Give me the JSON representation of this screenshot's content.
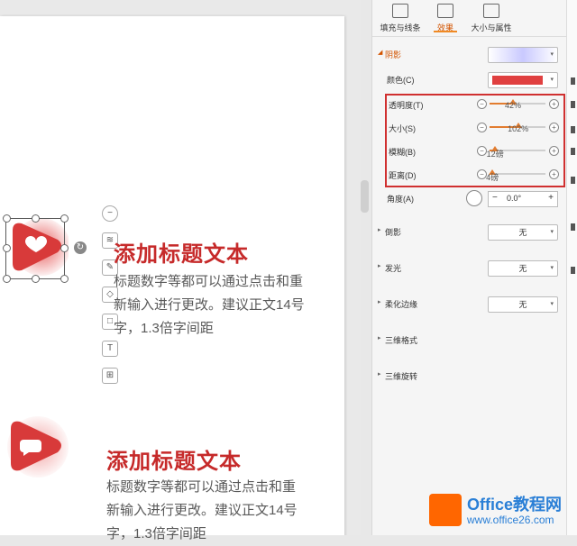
{
  "slide": {
    "blocks": [
      {
        "title": "添加标题文本",
        "body": "标题数字等都可以通过点击和重新输入进行更改。建议正文14号字，1.3倍字间距"
      },
      {
        "title": "添加标题文本",
        "body": "标题数字等都可以通过点击和重新输入进行更改。建议正文14号字，1.3倍字间距"
      }
    ],
    "accent_color": "#d83a3a"
  },
  "float_toolbar": {
    "icons": [
      "minus-circle-icon",
      "layers-icon",
      "pen-icon",
      "fill-icon",
      "outline-icon",
      "text-wrap-icon",
      "group-icon"
    ]
  },
  "panel": {
    "tabs": [
      {
        "label": "填充与线条",
        "icon": "paint-bucket-icon"
      },
      {
        "label": "效果",
        "icon": "effects-icon",
        "active": true
      },
      {
        "label": "大小与属性",
        "icon": "size-icon"
      }
    ],
    "shadow": {
      "label": "阴影",
      "color_label": "颜色(C)",
      "color": "#e04040",
      "preset_color": "#c9c9ff",
      "transparency": {
        "label": "透明度(T)",
        "value_text": "42%",
        "fraction": 0.42
      },
      "size": {
        "label": "大小(S)",
        "value_text": "102%",
        "fraction": 0.51
      },
      "blur": {
        "label": "模糊(B)",
        "value_text": "12磅",
        "fraction": 0.1
      },
      "distance": {
        "label": "距离(D)",
        "value_text": "4磅",
        "fraction": 0.05
      },
      "angle": {
        "label": "角度(A)",
        "value": "0.0°",
        "minus": "−",
        "plus": "+"
      }
    },
    "sections": [
      {
        "label": "倒影",
        "value": "无"
      },
      {
        "label": "发光",
        "value": "无"
      },
      {
        "label": "柔化边缘",
        "value": "无"
      },
      {
        "label": "三维格式"
      },
      {
        "label": "三维旋转"
      }
    ]
  },
  "watermark": {
    "line1": "Office教程网",
    "line2": "www.office26.com"
  }
}
